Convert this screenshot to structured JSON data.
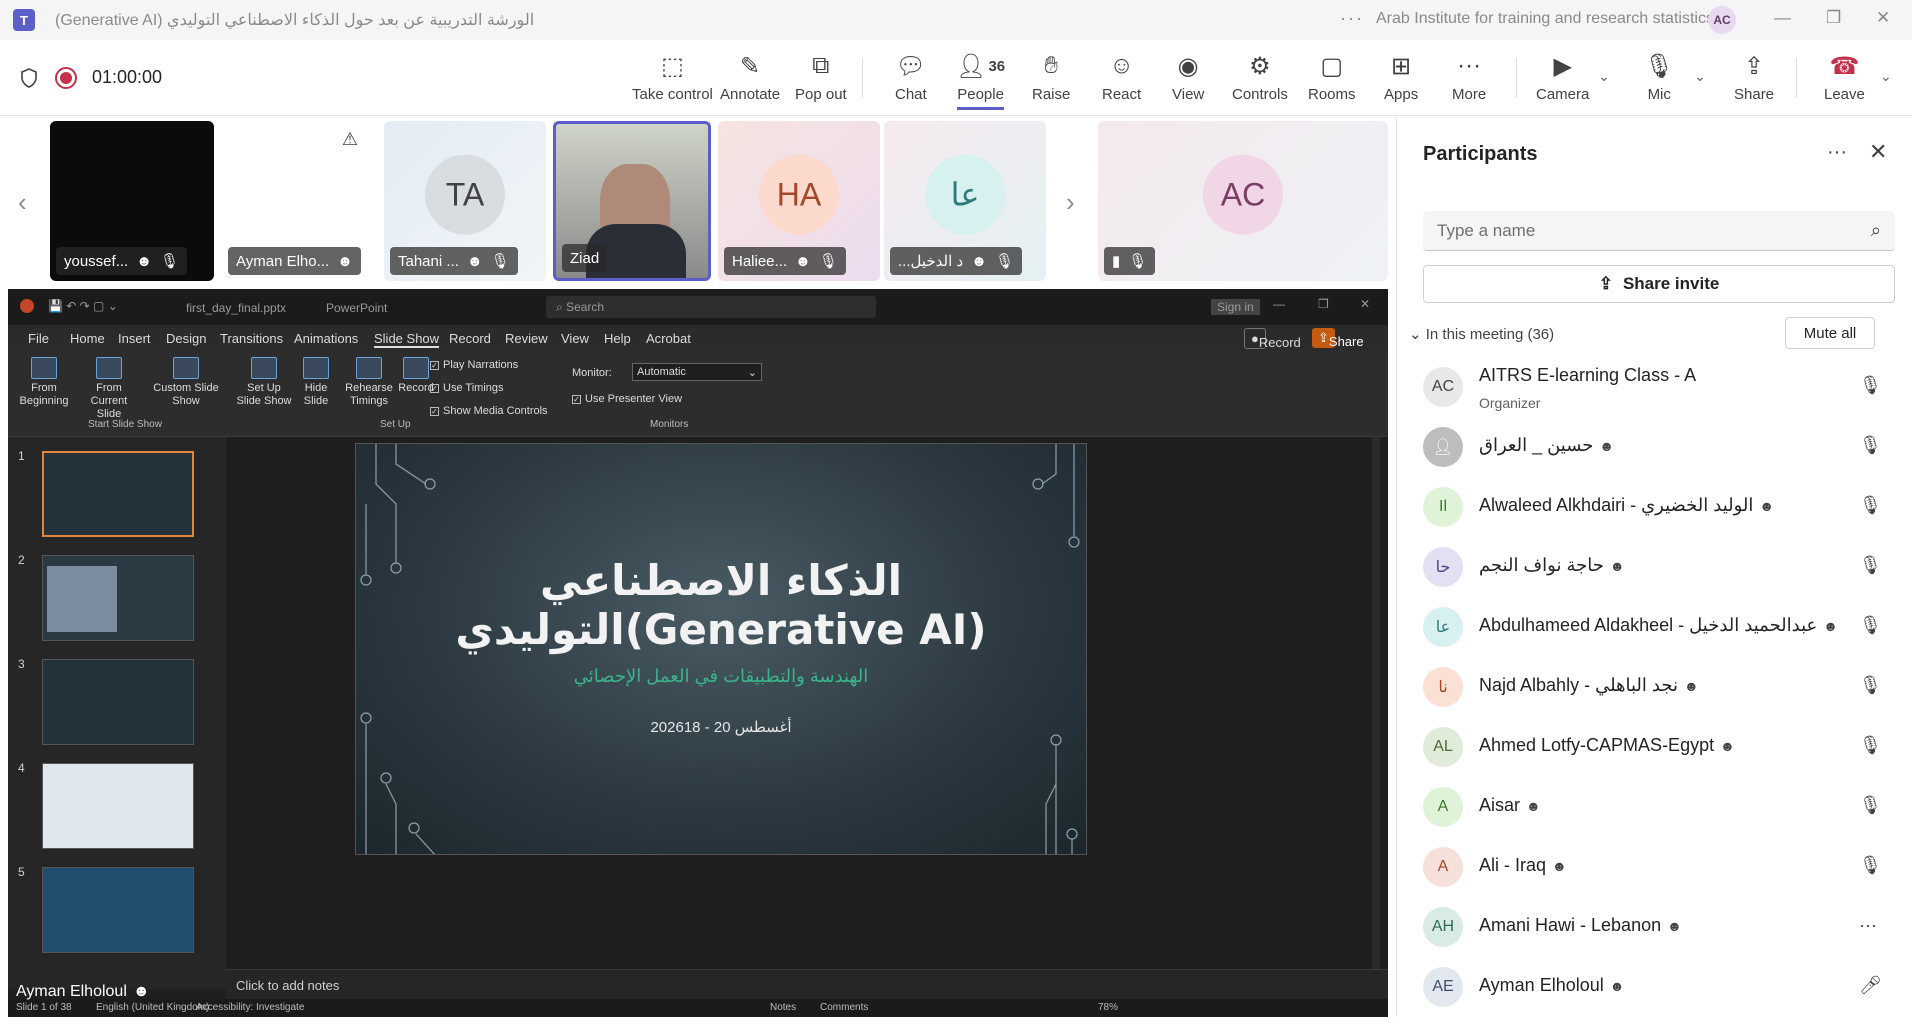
{
  "window": {
    "title": "(Generative AI) الورشة التدريبية عن بعد حول الذكاء الاصطناعي التوليدي",
    "org": "Arab Institute for training and research statistics",
    "user_initials": "AC"
  },
  "toolbar": {
    "timer": "01:00:00",
    "take_control": "Take control",
    "annotate": "Annotate",
    "pop_out": "Pop out",
    "chat": "Chat",
    "people": "People",
    "people_count": "36",
    "raise": "Raise",
    "react": "React",
    "view": "View",
    "controls": "Controls",
    "rooms": "Rooms",
    "apps": "Apps",
    "more": "More",
    "camera": "Camera",
    "mic": "Mic",
    "share": "Share",
    "leave": "Leave"
  },
  "strip": {
    "tiles": [
      {
        "name": "youssef..."
      },
      {
        "name": "Ayman Elho..."
      },
      {
        "name": "Tahani ...",
        "initials": "TA"
      },
      {
        "name": "Ziad"
      },
      {
        "name": "Haliee...",
        "initials": "HA"
      },
      {
        "name": "...د الدخيل",
        "initials": "عا"
      },
      {
        "name": "",
        "initials": "AC"
      }
    ]
  },
  "ppt": {
    "filename": "first_day_final.pptx",
    "app": "PowerPoint",
    "search": "Search",
    "sign_in": "Sign in",
    "menus": [
      "File",
      "Home",
      "Insert",
      "Design",
      "Transitions",
      "Animations",
      "Slide Show",
      "Record",
      "Review",
      "View",
      "Help",
      "Acrobat"
    ],
    "record_btn": "Record",
    "share_btn": "Share",
    "ribbon": {
      "from_beginning": "From Beginning",
      "from_current": "From Current Slide",
      "custom_show": "Custom Slide Show",
      "start_group": "Start Slide Show",
      "setup_show": "Set Up Slide Show",
      "hide_slide": "Hide Slide",
      "rehearse": "Rehearse Timings",
      "record": "Record",
      "play_narrations": "Play Narrations",
      "use_timings": "Use Timings",
      "show_media": "Show Media Controls",
      "setup_group": "Set Up",
      "monitor_label": "Monitor:",
      "monitor_value": "Automatic",
      "presenter_view": "Use Presenter View",
      "monitors_group": "Monitors"
    },
    "thumb_numbers": [
      "1",
      "2",
      "3",
      "4",
      "5"
    ],
    "slide": {
      "title": "الذكاء الاصطناعي التوليدي(Generative AI)",
      "subtitle": "الهندسة والتطبيقات في العمل الإحصائي",
      "date": "2026أغسطس 20 - 18"
    },
    "notes": "Click to add notes",
    "status": {
      "slide": "Slide 1 of 38",
      "language": "English (United Kingdom)",
      "accessibility": "Accessibility: Investigate",
      "notes": "Notes",
      "comments": "Comments",
      "zoom": "78%"
    }
  },
  "presenter_label": "Ayman Elholoul",
  "panel": {
    "title": "Participants",
    "search_placeholder": "Type a name",
    "share_invite": "Share invite",
    "in_meeting": "In this meeting (36)",
    "mute_all": "Mute all",
    "participants": [
      {
        "initials": "AC",
        "name": "AITRS E-learning Class - A",
        "role": "Organizer"
      },
      {
        "initials": "",
        "name": "حسين _ العراق"
      },
      {
        "initials": "Il",
        "name": "Alwaleed Alkhdairi - الوليد الخضيري"
      },
      {
        "initials": "حا",
        "name": "حاجة نواف النجم"
      },
      {
        "initials": "عا",
        "name": "Abdulhameed Aldakheel - عبدالحميد الدخيل"
      },
      {
        "initials": "نا",
        "name": "Najd Albahly - نجد الباهلي"
      },
      {
        "initials": "AL",
        "name": "Ahmed Lotfy-CAPMAS-Egypt"
      },
      {
        "initials": "A",
        "name": "Aisar"
      },
      {
        "initials": "A",
        "name": "Ali - Iraq"
      },
      {
        "initials": "AH",
        "name": "Amani Hawi - Lebanon"
      },
      {
        "initials": "AE",
        "name": "Ayman Elholoul"
      }
    ]
  },
  "colors": {
    "accent": "#5b5fc7",
    "leave": "#c4314b",
    "slide_subtitle": "#39b58c"
  }
}
